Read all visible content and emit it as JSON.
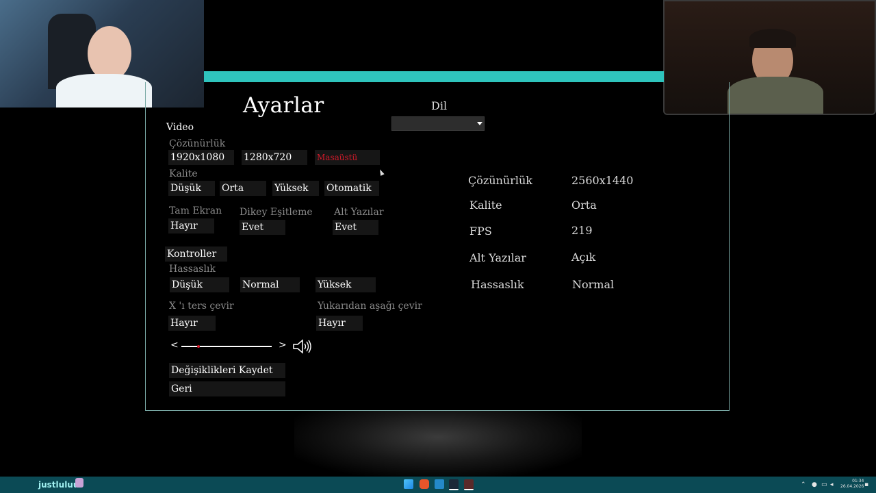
{
  "title": "Ayarlar",
  "language": {
    "label": "Dil",
    "value": ""
  },
  "video": {
    "section": "Video",
    "resolution": {
      "label": "Çözünürlük",
      "options": [
        "1920x1080",
        "1280x720",
        "Masaüstü"
      ]
    },
    "quality": {
      "label": "Kalite",
      "options": [
        "Düşük",
        "Orta",
        "Yüksek",
        "Otomatik"
      ]
    },
    "fullscreen": {
      "label": "Tam Ekran",
      "value": "Hayır"
    },
    "vsync": {
      "label": "Dikey Eşitleme",
      "value": "Evet"
    },
    "subtitles": {
      "label": "Alt Yazılar",
      "value": "Evet"
    }
  },
  "controls": {
    "section": "Kontroller",
    "sensitivity": {
      "label": "Hassaslık",
      "options": [
        "Düşük",
        "Normal",
        "Yüksek"
      ]
    },
    "invert_x": {
      "label": "X 'ı ters çevir",
      "value": "Hayır"
    },
    "invert_y": {
      "label": "Yukarıdan aşağı çevir",
      "value": "Hayır"
    }
  },
  "volume": {
    "left_arrow": "<",
    "right_arrow": ">",
    "level": 0.19,
    "icon": "speaker-icon"
  },
  "buttons": {
    "save": "Değişiklikleri Kaydet",
    "back": "Geri"
  },
  "info": [
    {
      "key": "Çözünürlük",
      "value": "2560x1440"
    },
    {
      "key": "Kalite",
      "value": "Orta"
    },
    {
      "key": "FPS",
      "value": "219"
    },
    {
      "key": "Alt Yazılar",
      "value": "Açık"
    },
    {
      "key": "Hassaslık",
      "value": "Normal"
    }
  ],
  "taskbar": {
    "username": "justluluu",
    "time": "01:34",
    "date": "26.04.2026"
  },
  "colors": {
    "accent": "#2fc4bd",
    "selected": "#d11a2a",
    "taskbar": "#0b4a55"
  }
}
